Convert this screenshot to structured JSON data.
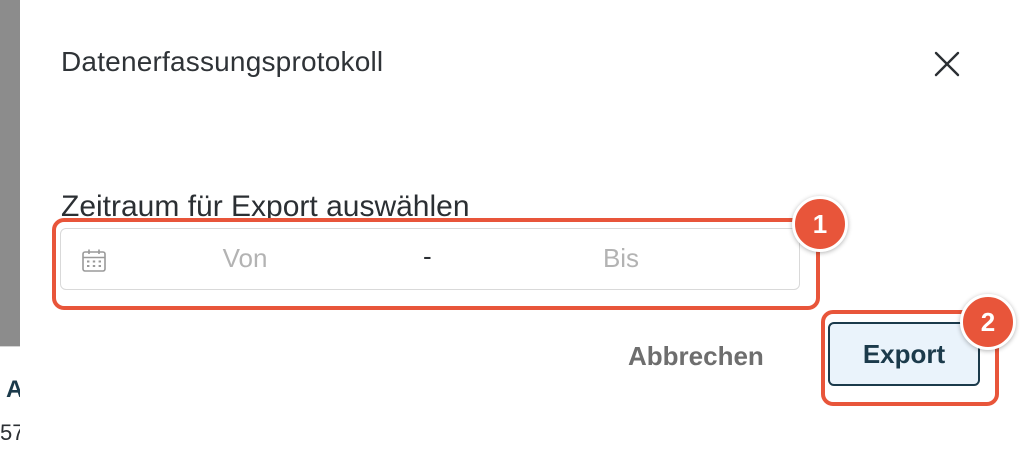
{
  "dialog": {
    "title": "Datenerfassungsprotokoll",
    "close_icon": "close-icon"
  },
  "date_range": {
    "label": "Zeitraum für Export auswählen",
    "icon": "calendar-icon",
    "from_placeholder": "Von",
    "separator": "-",
    "to_placeholder": "Bis"
  },
  "actions": {
    "cancel_label": "Abbrechen",
    "export_label": "Export"
  },
  "annotations": {
    "step_1": "1",
    "step_2": "2",
    "color": "#e8553a"
  },
  "background": {
    "partial_letter": "A",
    "partial_number": "57"
  },
  "colors": {
    "primary": "#1b3a4b",
    "button_bg": "#eaf3fb",
    "placeholder": "#b3b3b3"
  }
}
